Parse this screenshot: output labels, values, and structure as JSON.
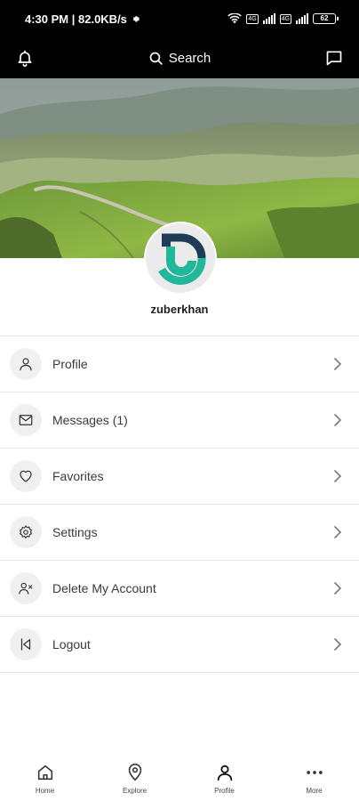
{
  "status_bar": {
    "time_speed": "4:30 PM | 82.0KB/s",
    "sim1": "4G",
    "sim2": "4G",
    "battery": "62"
  },
  "top_bar": {
    "search_label": "Search",
    "icons": [
      "bell-icon",
      "search-icon",
      "chat-icon"
    ]
  },
  "profile": {
    "username": "zuberkhan",
    "avatar_colors": {
      "navy": "#1f3b57",
      "teal": "#22b79b"
    }
  },
  "menu": {
    "items": [
      {
        "label": "Profile",
        "icon": "user-icon"
      },
      {
        "label": "Messages (1)",
        "icon": "mail-icon"
      },
      {
        "label": "Favorites",
        "icon": "heart-icon"
      },
      {
        "label": "Settings",
        "icon": "gear-icon"
      },
      {
        "label": "Delete My Account",
        "icon": "user-remove-icon"
      },
      {
        "label": "Logout",
        "icon": "logout-icon"
      }
    ]
  },
  "bottom_nav": {
    "items": [
      {
        "label": "Home",
        "icon": "home-icon"
      },
      {
        "label": "Explore",
        "icon": "location-pin-icon"
      },
      {
        "label": "Profile",
        "icon": "user-icon",
        "active": true
      },
      {
        "label": "More",
        "icon": "more-dots-icon"
      }
    ]
  }
}
